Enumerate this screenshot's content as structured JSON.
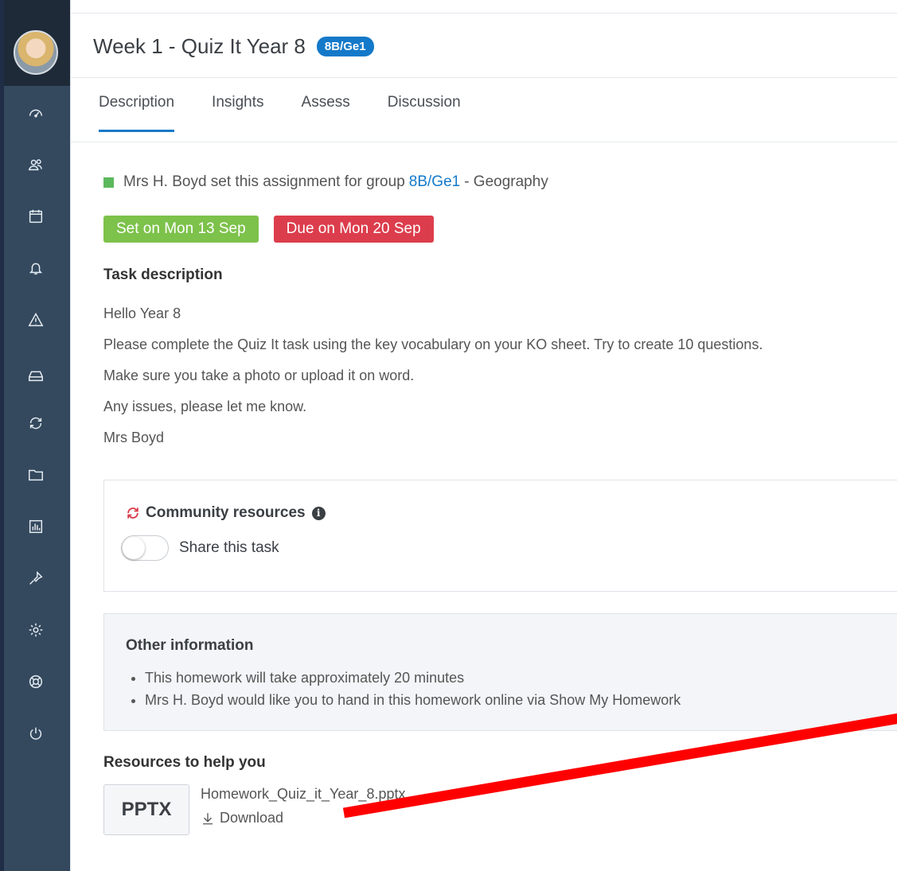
{
  "sidebar": {
    "avatar_alt": "user avatar",
    "items": [
      {
        "icon": "dashboard-icon"
      },
      {
        "icon": "people-icon"
      },
      {
        "icon": "calendar-icon"
      },
      {
        "icon": "bell-icon"
      },
      {
        "icon": "warning-icon"
      },
      {
        "icon": "inbox-icon"
      },
      {
        "icon": "sync-icon"
      },
      {
        "icon": "folder-icon"
      },
      {
        "icon": "chart-icon"
      },
      {
        "icon": "pin-icon"
      },
      {
        "icon": "gear-icon"
      },
      {
        "icon": "lifebuoy-icon"
      },
      {
        "icon": "power-icon"
      }
    ]
  },
  "header": {
    "title": "Week 1 - Quiz It Year 8",
    "group_badge": "8B/Ge1"
  },
  "tabs": [
    {
      "label": "Description",
      "active": true
    },
    {
      "label": "Insights"
    },
    {
      "label": "Assess"
    },
    {
      "label": "Discussion"
    }
  ],
  "assignment": {
    "setter_prefix": "Mrs H. Boyd set this assignment for group",
    "group_link": "8B/Ge1",
    "subject_suffix": "- Geography",
    "set_date": "Set on Mon 13 Sep",
    "due_date": "Due on Mon 20 Sep",
    "status_color": "#5cb85c"
  },
  "task": {
    "heading": "Task description",
    "lines": [
      "Hello Year 8",
      "Please complete the Quiz It task using the key vocabulary on your KO sheet. Try to create 10 questions.",
      "Make sure you take a photo or upload it on word.",
      "Any issues, please let me know.",
      "Mrs Boyd"
    ]
  },
  "community": {
    "title": "Community resources",
    "share_label": "Share this task",
    "share_enabled": false
  },
  "other_info": {
    "heading": "Other information",
    "items": [
      "This homework will take approximately 20 minutes",
      "Mrs H. Boyd would like you to hand in this homework online via Show My Homework"
    ]
  },
  "resources": {
    "heading": "Resources to help you",
    "file_type": "PPTX",
    "file_name": "Homework_Quiz_it_Year_8.pptx",
    "download_label": "Download"
  },
  "colors": {
    "accent": "#1479c9",
    "set_badge": "#7dc24b",
    "due_badge": "#dc3d4c",
    "sidebar": "#34495e",
    "annotation_arrow": "#ff0000"
  }
}
